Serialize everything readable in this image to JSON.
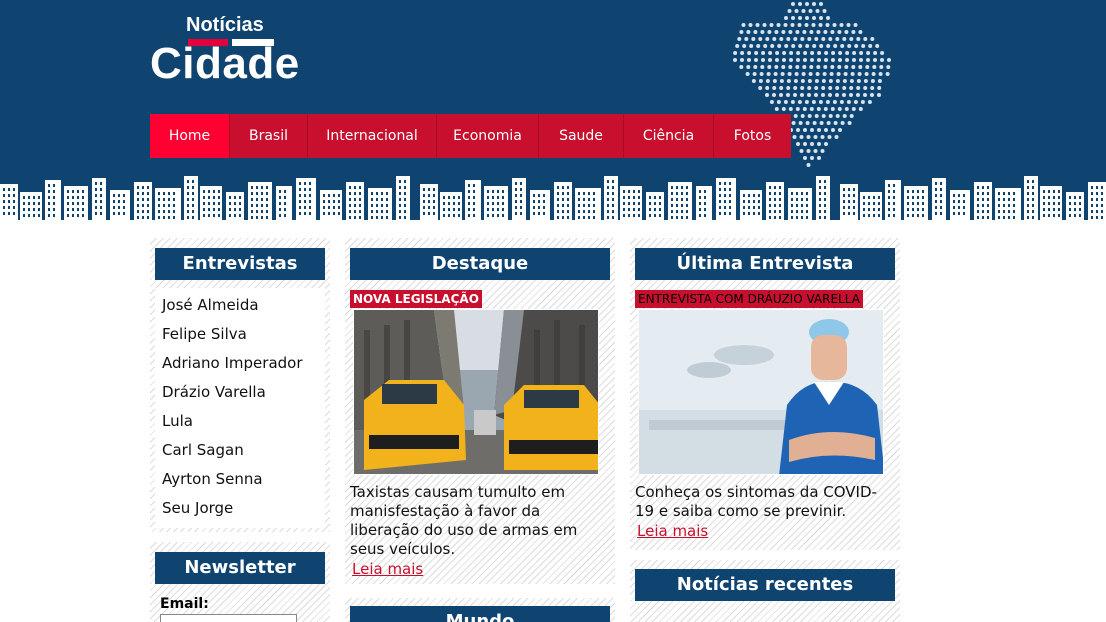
{
  "header": {
    "logo_top": "Notícias",
    "logo_main": "Cidade",
    "colors": {
      "background": "#0f4470",
      "nav": "#c8102e",
      "nav_active": "#ff0033"
    }
  },
  "nav": {
    "items": [
      {
        "label": "Home",
        "active": true
      },
      {
        "label": "Brasil"
      },
      {
        "label": "Internacional"
      },
      {
        "label": "Economia"
      },
      {
        "label": "Saude"
      },
      {
        "label": "Ciência"
      },
      {
        "label": "Fotos"
      }
    ]
  },
  "entrevistas": {
    "title": "Entrevistas",
    "items": [
      "José Almeida",
      "Felipe Silva",
      "Adriano Imperador",
      "Drázio Varella",
      "Lula",
      "Carl Sagan",
      "Ayrton Senna",
      "Seu Jorge"
    ]
  },
  "newsletter": {
    "title": "Newsletter",
    "email_label": "Email:",
    "email_value": ""
  },
  "destaque": {
    "title": "Destaque",
    "tag": "NOVA LEGISLAÇÃO",
    "text": "Taxistas causam tumulto em manisfestação à favor da liberação do uso de armas em seus veículos.",
    "more": "Leia mais"
  },
  "ultima": {
    "title": "Última Entrevista",
    "tag": "ENTREVISTA COM DRÁUZIO VARELLA",
    "text": "Conheça os sintomas da COVID-19 e saiba como se previnir.",
    "more": "Leia mais"
  },
  "mundo": {
    "title": "Mundo"
  },
  "recentes": {
    "title": "Notícias recentes"
  }
}
